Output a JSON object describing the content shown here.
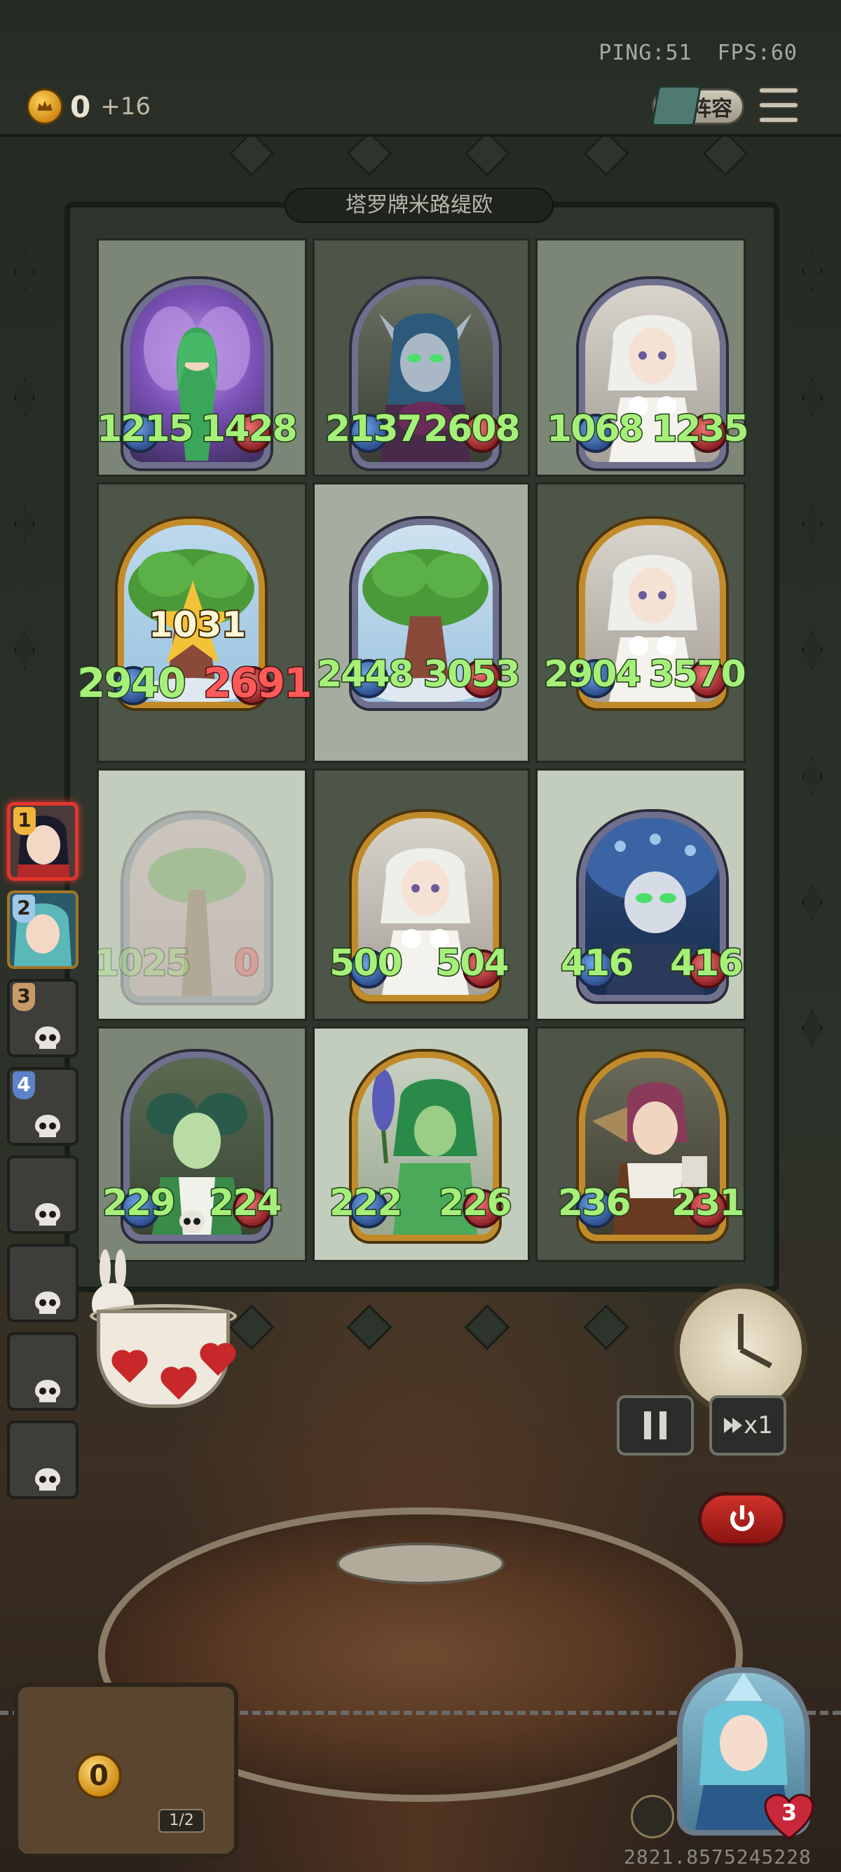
{
  "header": {
    "ping": "PING:51",
    "fps": "FPS:60",
    "gold": "0",
    "gold_income": "+16",
    "lineup_label": "阵容"
  },
  "board": {
    "title": "塔罗牌米路缇欧",
    "cells": [
      {
        "icon": "fairy-portrait",
        "frame": "silver",
        "atk": "1215",
        "hp": "1428"
      },
      {
        "icon": "vampire-portrait",
        "frame": "silver",
        "atk": "2137",
        "hp": "2608"
      },
      {
        "icon": "white-hair-girl-portrait",
        "frame": "silver",
        "atk": "1068",
        "hp": "1235"
      },
      {
        "icon": "tree-portrait",
        "frame": "gold",
        "atk": "2940",
        "hp": "2691",
        "badge": "1031"
      },
      {
        "icon": "tree-portrait",
        "frame": "silver",
        "atk": "2448",
        "hp": "3053"
      },
      {
        "icon": "white-hair-girl-portrait",
        "frame": "gold",
        "atk": "2904",
        "hp": "3570"
      },
      {
        "icon": "tree-portrait",
        "frame": "ghost",
        "atk": "1025",
        "hp": "0"
      },
      {
        "icon": "white-hair-girl-portrait",
        "frame": "gold",
        "atk": "500",
        "hp": "504"
      },
      {
        "icon": "vampire-portrait",
        "frame": "silver",
        "atk": "416",
        "hp": "416"
      },
      {
        "icon": "maid-portrait",
        "frame": "silver",
        "atk": "229",
        "hp": "224"
      },
      {
        "icon": "forest-dryad-portrait",
        "frame": "gold",
        "atk": "222",
        "hp": "226"
      },
      {
        "icon": "merchant-girl-portrait",
        "frame": "gold",
        "atk": "236",
        "hp": "231"
      }
    ]
  },
  "bench": [
    {
      "num": "1",
      "icon": "dark-hair-player-portrait"
    },
    {
      "num": "2",
      "icon": "teal-hair-player-portrait"
    },
    {
      "num": "3",
      "icon": "skull-icon"
    },
    {
      "num": "4",
      "icon": "skull-icon"
    },
    {
      "num": "",
      "icon": "skull-icon"
    },
    {
      "num": "",
      "icon": "skull-icon"
    },
    {
      "num": "",
      "icon": "skull-icon"
    },
    {
      "num": "",
      "icon": "skull-icon"
    }
  ],
  "controls": {
    "speed_label": "x1"
  },
  "bottom": {
    "chest_coins": "0",
    "chest_page": "1/2",
    "hero_hp": "3",
    "seed": "2821.8575245228"
  },
  "colors": {
    "atk_green": "#a6f07a",
    "hp_dead_red": "#ff5a5a",
    "gold_frame": "#c28b2a",
    "silver_frame": "#6f6f8e",
    "active_red": "#e0352d"
  }
}
